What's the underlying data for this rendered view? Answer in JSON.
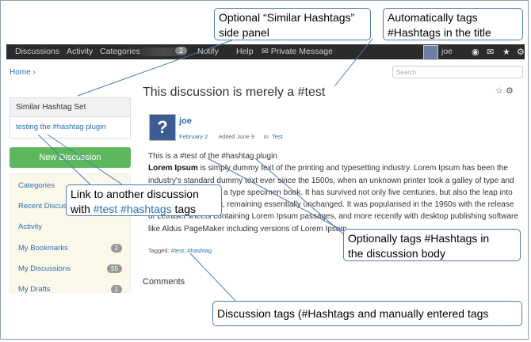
{
  "nav": {
    "discussions": "Discussions",
    "activity": "Activity",
    "categories": "Categories",
    "badge": "2",
    "notify": "Notify",
    "help": "Help",
    "private_message": "✉ Private Message",
    "username": "joe"
  },
  "breadcrumb": "Home ›",
  "search_placeholder": "Search",
  "sidebar": {
    "box_title": "Similar Hashtag Set",
    "box_link": "testing the #hashtag plugin",
    "new_discussion": "New Discussion",
    "menu": [
      {
        "label": "Categories",
        "count": ""
      },
      {
        "label": "Recent Discussions",
        "count": ""
      },
      {
        "label": "Activity",
        "count": ""
      },
      {
        "label": "My Bookmarks",
        "count": "2"
      },
      {
        "label": "My Discussions",
        "count": "55"
      },
      {
        "label": "My Drafts",
        "count": "1"
      }
    ]
  },
  "discussion": {
    "title": "This discussion is merely a #test",
    "author": "joe",
    "date": "February 2",
    "edited": "edited June 9",
    "in_label": "in",
    "category": "Test",
    "intro": "This is a #test of the #hashtag plugin",
    "lorem_bold": "Lorem Ipsum",
    "lorem_rest": " is simply dummy text of the printing and typesetting industry. Lorem Ipsum has been the industry's standard dummy text ever since the 1500s, when an unknown printer took a galley of type and scrambled it to make a type specimen book. It has survived not only five centuries, but also the leap into electronic typesetting, remaining essentially unchanged. It was popularised in the 1960s with the release of Letraset sheets containing Lorem Ipsum passages, and more recently with desktop publishing software like Aldus PageMaker including versions of Lorem Ipsum.",
    "tags_label": "Tagged:",
    "tags": "#test, #hashtag",
    "comments_heading": "Comments"
  },
  "callouts": {
    "side_panel_1": "Optional “Similar Hashtags”",
    "side_panel_2": "side panel",
    "auto_tags_1": "Automatically tags",
    "auto_tags_2": "#Hashtags in the title",
    "link_1": "Link to another discussion",
    "link_2a": "with ",
    "link_2b": "#test #hashtags",
    "link_2c": " tags",
    "body_tags_1": "Optionally tags #Hashtags in",
    "body_tags_2": "the discussion body",
    "disc_tags": "Discussion tags (#Hashtags and manually entered tags"
  }
}
